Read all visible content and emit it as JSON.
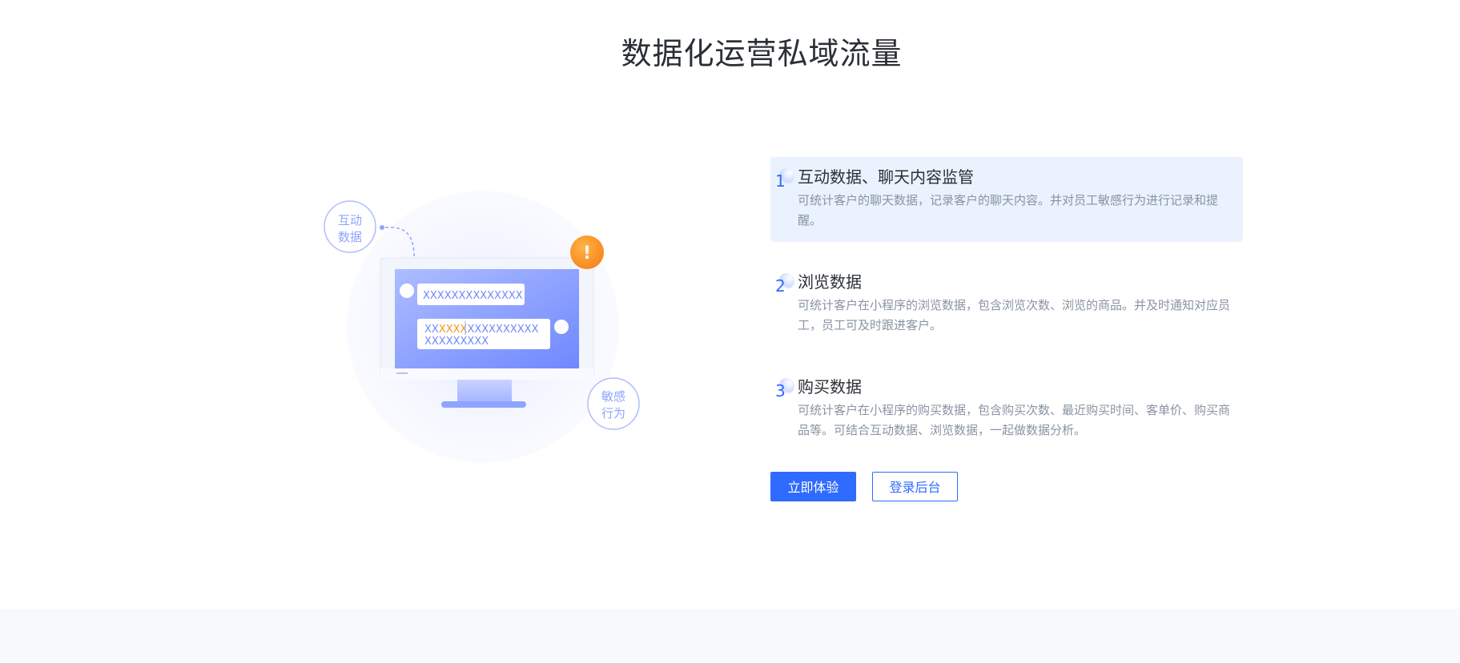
{
  "page": {
    "title": "数据化运营私域流量"
  },
  "illustration": {
    "bubble_top_left": "互动\n数据",
    "bubble_top_left_line1": "互动",
    "bubble_top_left_line2": "数据",
    "bubble_bottom_right_line1": "敏感",
    "bubble_bottom_right_line2": "行为",
    "chat_line1": "XXXXXXXXXXXXXX",
    "chat_line2_a": "XX",
    "chat_line2_b": "XXXX",
    "chat_line2_c": "XXXXXXXXXX",
    "chat_line3": "XXXXXXXXX",
    "alert_symbol": "!",
    "colors": {
      "accent": "#2f6bff",
      "alert": "#f7941d",
      "screen": "#7b93ff"
    }
  },
  "features": [
    {
      "number": "1",
      "title": "互动数据、聊天内容监管",
      "desc": "可统计客户的聊天数据，记录客户的聊天内容。并对员工敏感行为进行记录和提醒。",
      "active": true
    },
    {
      "number": "2",
      "title": "浏览数据",
      "desc": "可统计客户在小程序的浏览数据，包含浏览次数、浏览的商品。并及时通知对应员工，员工可及时跟进客户。",
      "active": false
    },
    {
      "number": "3",
      "title": "购买数据",
      "desc": "可统计客户在小程序的购买数据，包含购买次数、最近购买时间、客单价、购买商品等。可结合互动数据、浏览数据，一起做数据分析。",
      "active": false
    }
  ],
  "buttons": {
    "try_now": "立即体验",
    "login_backend": "登录后台"
  }
}
